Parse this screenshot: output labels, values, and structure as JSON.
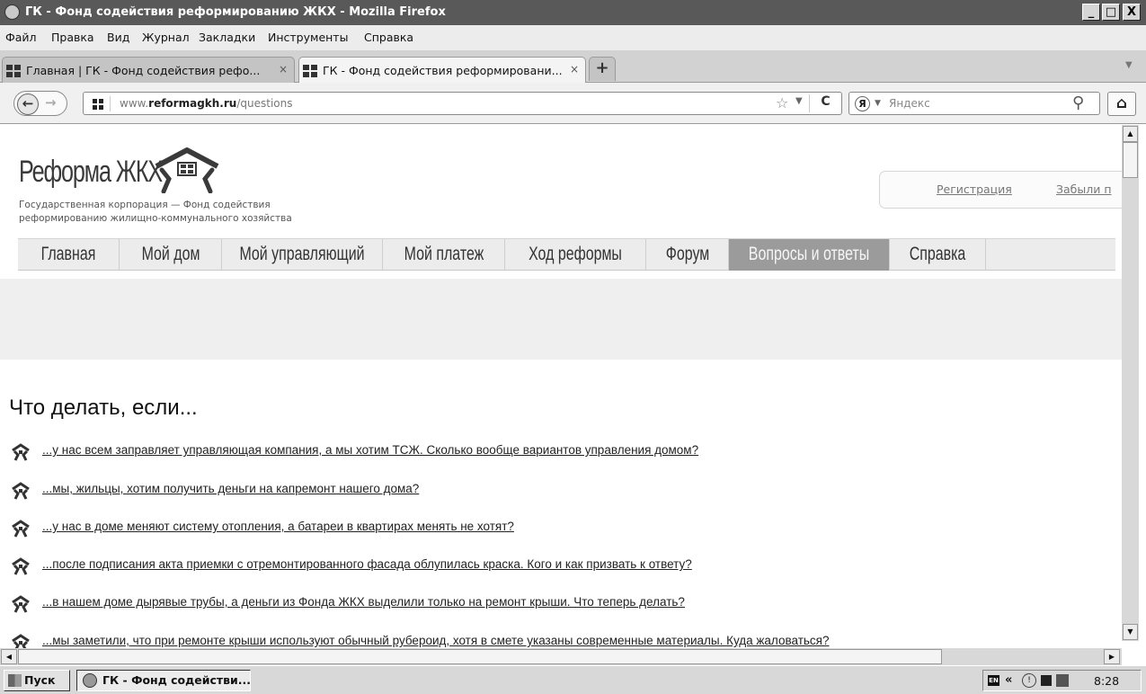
{
  "window": {
    "title": "ГК - Фонд содействия реформированию ЖКХ - Mozilla Firefox",
    "controls": [
      "_",
      "🗗",
      "X"
    ]
  },
  "menu": [
    "Файл",
    "Правка",
    "Вид",
    "Журнал",
    "Закладки",
    "Инструменты",
    "Справка"
  ],
  "tabs": [
    {
      "label": "Главная | ГК - Фонд содействия рефо...",
      "close": "×",
      "active": false
    },
    {
      "label": "ГК - Фонд содействия реформировани...",
      "close": "×",
      "active": true
    }
  ],
  "new_tab": "+",
  "nav": {
    "url_host": "www.",
    "url_domain": "reformagkh.ru",
    "url_path": "/questions",
    "search_placeholder": "Яндекс",
    "search_engine_mark": "Я"
  },
  "site": {
    "logo_title": "Реформа ЖКХ",
    "logo_sub1": "Государственная корпорация — Фонд содействия",
    "logo_sub2": "реформированию жилищно-коммунального хозяйства",
    "auth": {
      "register": "Регистрация",
      "forgot": "Забыли п"
    },
    "nav_items": [
      "Главная",
      "Мой дом",
      "Мой управляющий",
      "Мой платеж",
      "Ход реформы",
      "Форум",
      "Вопросы и ответы",
      "Справка"
    ],
    "active_nav": "Вопросы и ответы",
    "faq_title": "Что делать, если...",
    "questions": [
      "...у нас всем заправляет управляющая компания, а мы хотим ТСЖ. Сколько вообще вариантов управления домом?",
      "...мы, жильцы, хотим получить деньги на капремонт нашего дома?",
      "...у нас в доме меняют систему отопления, а батареи в квартирах менять не хотят?",
      "...после подписания акта приемки с отремонтированного фасада облупилась краска. Кого и как призвать к ответу?",
      "...в нашем доме дырявые трубы, а деньги из Фонда ЖКХ выделили только на ремонт крыши. Что теперь делать?",
      "...мы заметили, что при ремонте крыши используют обычный рубероид, хотя в смете указаны современные материалы. Куда жаловаться?"
    ]
  },
  "taskbar": {
    "start": "Пуск",
    "window_label": "ГК - Фонд содействи...",
    "lang": "EN",
    "clock": "8:28"
  },
  "colors": {
    "active_nav_bg": "#9b9b9b",
    "nav_bg": "#ececec",
    "titlebar": "#595959"
  }
}
